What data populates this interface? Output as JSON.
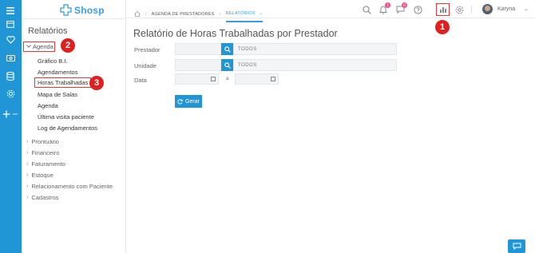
{
  "app": {
    "logo_text": "Shosp"
  },
  "sidebar": {
    "title": "Relatórios",
    "agenda_label": "Agenda",
    "agenda_items": [
      "Gráfico B.I.",
      "Agendamentos",
      "Horas Trabalhadas",
      "Mapa de Salas",
      "Agenda",
      "Última visita paciente",
      "Log de Agendamentos"
    ],
    "categories": [
      "Prontuário",
      "Financeiro",
      "Faturamento",
      "Estoque",
      "Relacionamento com Paciente",
      "Cadastros"
    ]
  },
  "header": {
    "breadcrumbs": [
      "AGENDA DE PRESTADORES",
      "RELATÓRIOS"
    ],
    "notifications_badge": "1",
    "messages_badge": "0",
    "user_name": "Karyna"
  },
  "markers": [
    "1",
    "2",
    "3"
  ],
  "main": {
    "title": "Relatório de Horas Trabalhadas por Prestador",
    "prestador_label": "Prestador",
    "unidade_label": "Unidade",
    "data_label": "Data",
    "prestador_value": "TODOS",
    "unidade_value": "TODOS",
    "date_separator": "a",
    "gerar_label": "Gerar"
  },
  "colors": {
    "accent": "#2196d6",
    "marker": "#e0201f",
    "badge": "#ec4f8a"
  }
}
